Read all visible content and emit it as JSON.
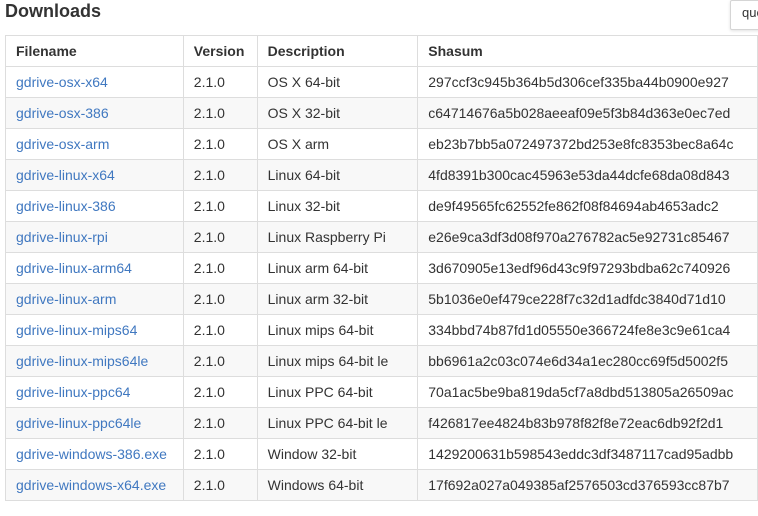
{
  "heading": "Downloads",
  "search": {
    "value": "que"
  },
  "table": {
    "headers": [
      "Filename",
      "Version",
      "Description",
      "Shasum"
    ],
    "rows": [
      {
        "filename": "gdrive-osx-x64",
        "version": "2.1.0",
        "description": "OS X 64-bit",
        "shasum": "297ccf3c945b364b5d306cef335ba44b0900e927"
      },
      {
        "filename": "gdrive-osx-386",
        "version": "2.1.0",
        "description": "OS X 32-bit",
        "shasum": "c64714676a5b028aeeaf09e5f3b84d363e0ec7ed"
      },
      {
        "filename": "gdrive-osx-arm",
        "version": "2.1.0",
        "description": "OS X arm",
        "shasum": "eb23b7bb5a072497372bd253e8fc8353bec8a64c"
      },
      {
        "filename": "gdrive-linux-x64",
        "version": "2.1.0",
        "description": "Linux 64-bit",
        "shasum": "4fd8391b300cac45963e53da44dcfe68da08d843"
      },
      {
        "filename": "gdrive-linux-386",
        "version": "2.1.0",
        "description": "Linux 32-bit",
        "shasum": "de9f49565fc62552fe862f08f84694ab4653adc2"
      },
      {
        "filename": "gdrive-linux-rpi",
        "version": "2.1.0",
        "description": "Linux Raspberry Pi",
        "shasum": "e26e9ca3df3d08f970a276782ac5e92731c85467"
      },
      {
        "filename": "gdrive-linux-arm64",
        "version": "2.1.0",
        "description": "Linux arm 64-bit",
        "shasum": "3d670905e13edf96d43c9f97293bdba62c740926"
      },
      {
        "filename": "gdrive-linux-arm",
        "version": "2.1.0",
        "description": "Linux arm 32-bit",
        "shasum": "5b1036e0ef479ce228f7c32d1adfdc3840d71d10"
      },
      {
        "filename": "gdrive-linux-mips64",
        "version": "2.1.0",
        "description": "Linux mips 64-bit",
        "shasum": "334bbd74b87fd1d05550e366724fe8e3c9e61ca4"
      },
      {
        "filename": "gdrive-linux-mips64le",
        "version": "2.1.0",
        "description": "Linux mips 64-bit le",
        "shasum": "bb6961a2c03c074e6d34a1ec280cc69f5d5002f5"
      },
      {
        "filename": "gdrive-linux-ppc64",
        "version": "2.1.0",
        "description": "Linux PPC 64-bit",
        "shasum": "70a1ac5be9ba819da5cf7a8dbd513805a26509ac"
      },
      {
        "filename": "gdrive-linux-ppc64le",
        "version": "2.1.0",
        "description": "Linux PPC 64-bit le",
        "shasum": "f426817ee4824b83b978f82f8e72eac6db92f2d1"
      },
      {
        "filename": "gdrive-windows-386.exe",
        "version": "2.1.0",
        "description": "Window 32-bit",
        "shasum": "1429200631b598543eddc3df3487117cad95adbb"
      },
      {
        "filename": "gdrive-windows-x64.exe",
        "version": "2.1.0",
        "description": "Windows 64-bit",
        "shasum": "17f692a027a049385af2576503cd376593cc87b7"
      }
    ]
  },
  "colors": {
    "link": "#4078c0",
    "text": "#333333",
    "border": "#dddddd",
    "stripe": "#f8f8f8"
  }
}
